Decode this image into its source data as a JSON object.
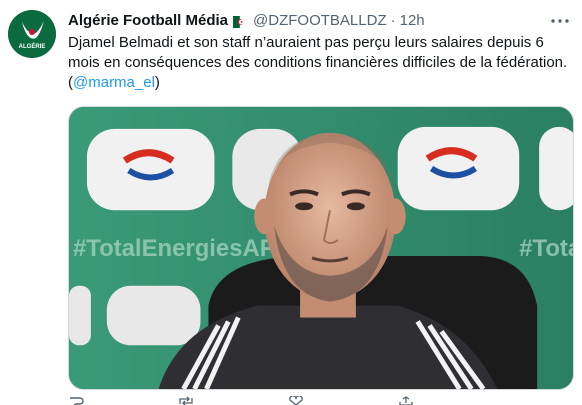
{
  "tweet": {
    "display_name": "Algérie Football Média",
    "handle": "@DZFOOTBALLDZ",
    "separator": "·",
    "time": "12h",
    "text": "Djamel Belmadi et son staff n’auraient pas perçu leurs salaires depuis 6 mois en conséquences des conditions financières difficiles de la fédération. ",
    "text_open": "(",
    "mention": "@marma_el",
    "text_close": ")",
    "avatar_label": "ALGÉRIE",
    "media_alt": "Photo of a man in a dark sports jacket at a press conference",
    "media_banner_text": "#TotalEnergiesAFCON",
    "media_right_text": "#Tota"
  },
  "icons": {
    "avatar": "algerie-football-media-logo",
    "flag": "algeria-flag-icon",
    "more": "more-options-icon",
    "reply": "reply-icon",
    "retweet": "retweet-icon",
    "like": "like-icon",
    "share": "share-icon"
  },
  "colors": {
    "link": "#1d9bf0",
    "secondary_text": "#536471",
    "primary_text": "#0f1419",
    "avatar_bg": "#0b6b3e",
    "media_bg": "#2f8a6a"
  }
}
